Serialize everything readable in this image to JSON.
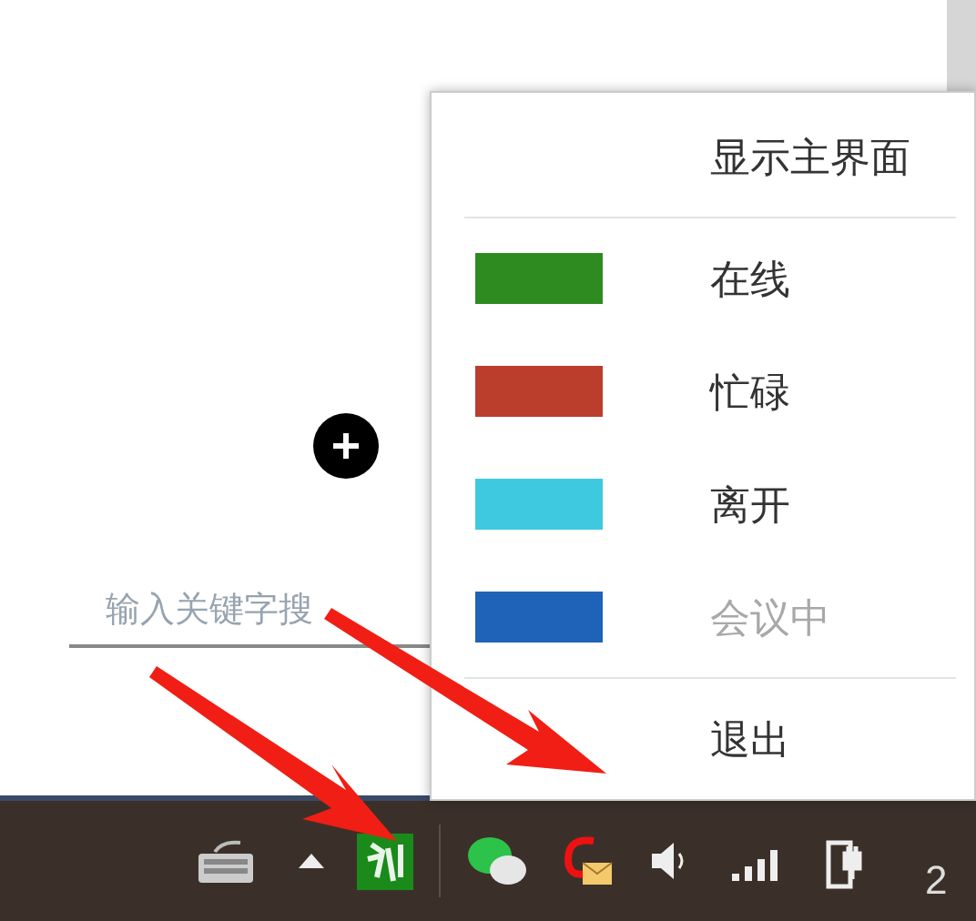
{
  "search": {
    "placeholder": "输入关键字搜"
  },
  "menu": {
    "items": [
      {
        "kind": "action",
        "label": "显示主界面",
        "disabled": false
      },
      {
        "kind": "separator"
      },
      {
        "kind": "status",
        "label": "在线",
        "color": "#2e8b1f",
        "disabled": false
      },
      {
        "kind": "status",
        "label": "忙碌",
        "color": "#bb3d2c",
        "disabled": false
      },
      {
        "kind": "status",
        "label": "离开",
        "color": "#3fc9e0",
        "disabled": false
      },
      {
        "kind": "status",
        "label": "会议中",
        "color": "#1e63b8",
        "disabled": true
      },
      {
        "kind": "separator"
      },
      {
        "kind": "action",
        "label": "退出",
        "disabled": false
      }
    ]
  },
  "taskbar": {
    "clock": "2"
  }
}
